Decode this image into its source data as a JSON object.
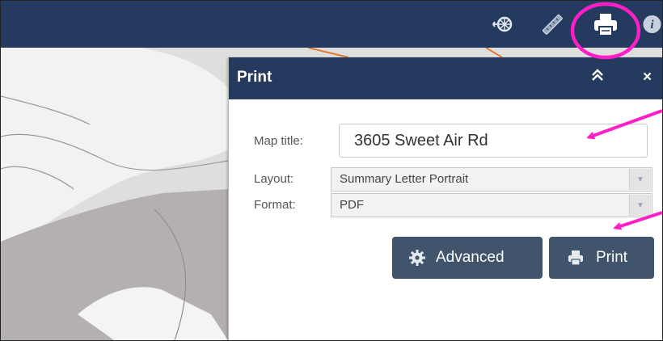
{
  "toolbar": {
    "icons": [
      "measure-icon",
      "ruler-icon",
      "print-icon",
      "info-icon"
    ]
  },
  "print_panel": {
    "title": "Print",
    "collapse_icon": "double-chevron-up-icon",
    "close_label": "×",
    "fields": {
      "map_title_label": "Map title:",
      "map_title_value": "3605 Sweet Air Rd",
      "layout_label": "Layout:",
      "layout_value": "Summary Letter Portrait",
      "format_label": "Format:",
      "format_value": "PDF"
    },
    "buttons": {
      "advanced_label": "Advanced",
      "print_label": "Print"
    }
  },
  "colors": {
    "header_bg": "#243a5e",
    "button_bg": "#40546c",
    "annotation": "#ff1fc7"
  }
}
